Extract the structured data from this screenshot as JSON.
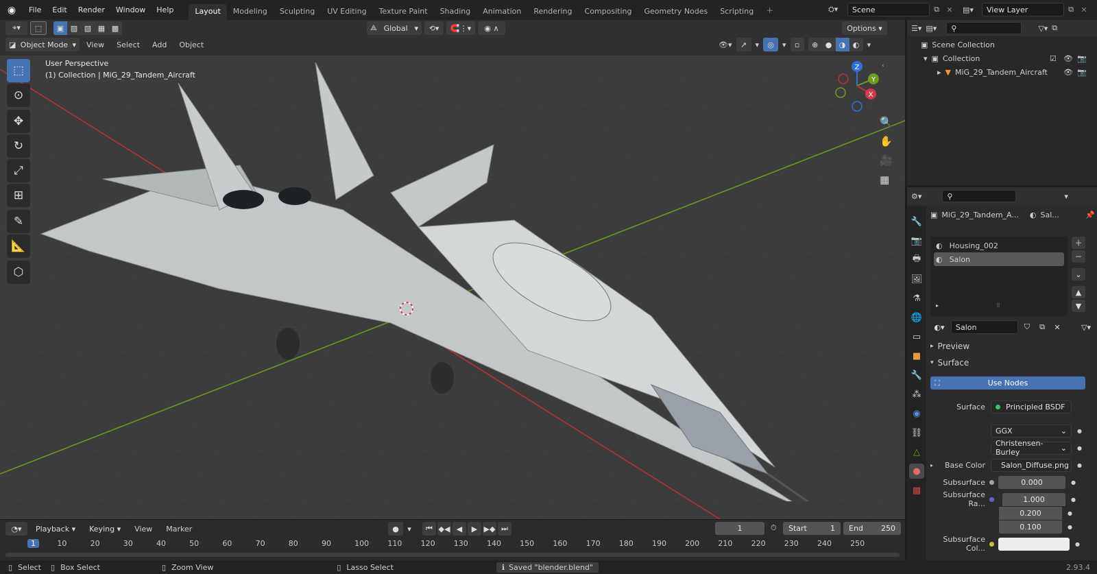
{
  "menu": [
    "File",
    "Edit",
    "Render",
    "Window",
    "Help"
  ],
  "workspaces": [
    "Layout",
    "Modeling",
    "Sculpting",
    "UV Editing",
    "Texture Paint",
    "Shading",
    "Animation",
    "Rendering",
    "Compositing",
    "Geometry Nodes",
    "Scripting"
  ],
  "active_workspace": "Layout",
  "scene_name": "Scene",
  "view_layer_name": "View Layer",
  "header": {
    "transform_orientation": "Global",
    "options": "Options",
    "mode": "Object Mode",
    "menus": [
      "View",
      "Select",
      "Add",
      "Object"
    ]
  },
  "viewport": {
    "perspective_label": "User Perspective",
    "collection_label": "(1) Collection | MiG_29_Tandem_Aircraft",
    "gizmo_x": "X",
    "gizmo_y": "Y",
    "gizmo_z": "Z"
  },
  "outliner": {
    "scene_collection": "Scene Collection",
    "collection": "Collection",
    "object": "MiG_29_Tandem_Aircraft"
  },
  "properties": {
    "object_name": "MiG_29_Tandem_A...",
    "material_short": "Sal...",
    "slots": [
      "Housing_002",
      "Salon"
    ],
    "active_slot": "Salon",
    "material_name": "Salon",
    "preview": "Preview",
    "surface_panel": "Surface",
    "use_nodes": "Use Nodes",
    "surface_label": "Surface",
    "surface_value": "Principled BSDF",
    "distribution": "GGX",
    "subsurface_method": "Christensen-Burley",
    "base_color_label": "Base Color",
    "base_color_value": "Salon_Diffuse.png",
    "subsurface_label": "Subsurface",
    "subsurface_value": "0.000",
    "subsurface_radius_label": "Subsurface Ra...",
    "subsurface_radius": [
      "1.000",
      "0.200",
      "0.100"
    ],
    "subsurface_color_label": "Subsurface Col..."
  },
  "timeline": {
    "menus": [
      "Playback",
      "Keying",
      "View",
      "Marker"
    ],
    "current_frame": "1",
    "start_label": "Start",
    "start": "1",
    "end_label": "End",
    "end": "250",
    "ticks": [
      "1",
      "10",
      "20",
      "30",
      "40",
      "50",
      "60",
      "70",
      "80",
      "90",
      "100",
      "110",
      "120",
      "130",
      "140",
      "150",
      "160",
      "170",
      "180",
      "190",
      "200",
      "210",
      "220",
      "230",
      "240",
      "250"
    ]
  },
  "status": {
    "select": "Select",
    "box_select": "Box Select",
    "zoom_view": "Zoom View",
    "lasso_select": "Lasso Select",
    "message": "Saved \"blender.blend\"",
    "version": "2.93.4"
  },
  "colors": {
    "accent": "#4772b3",
    "x_axis": "#b5353a",
    "y_axis": "#6a9c21",
    "z_axis": "#2f6edb",
    "header_bg": "#303030",
    "viewport_bg": "#3c3c3c"
  }
}
